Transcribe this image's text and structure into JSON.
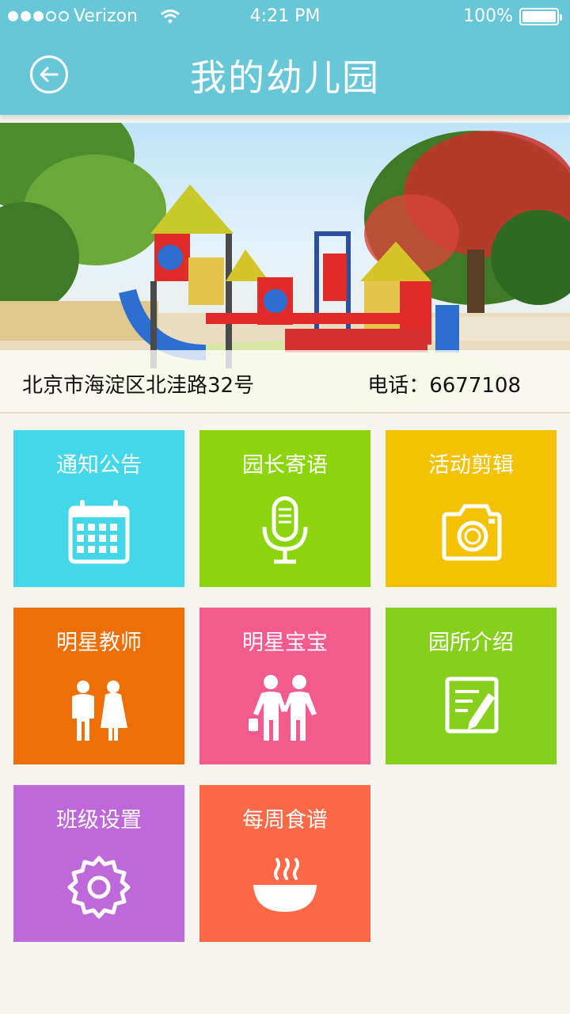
{
  "status": {
    "carrier": "Verizon",
    "time": "4:21 PM",
    "battery": "100%"
  },
  "header": {
    "title": "我的幼儿园",
    "back_icon": "back-arrow-circle-icon"
  },
  "banner": {
    "address": "北京市海淀区北洼路32号",
    "phone": "电话：6677108"
  },
  "tiles": [
    {
      "label": "通知公告",
      "icon": "calendar-icon",
      "color": "#44d7ea"
    },
    {
      "label": "园长寄语",
      "icon": "microphone-icon",
      "color": "#8cd50c"
    },
    {
      "label": "活动剪辑",
      "icon": "camera-icon",
      "color": "#f5c203"
    },
    {
      "label": "明星教师",
      "icon": "teachers-icon",
      "color": "#ed6f07"
    },
    {
      "label": "明星宝宝",
      "icon": "kids-icon",
      "color": "#f25b8c"
    },
    {
      "label": "园所介绍",
      "icon": "note-edit-icon",
      "color": "#86cf1c"
    },
    {
      "label": "班级设置",
      "icon": "gear-icon",
      "color": "#bf68da"
    },
    {
      "label": "每周食谱",
      "icon": "bowl-icon",
      "color": "#fd6847"
    }
  ]
}
